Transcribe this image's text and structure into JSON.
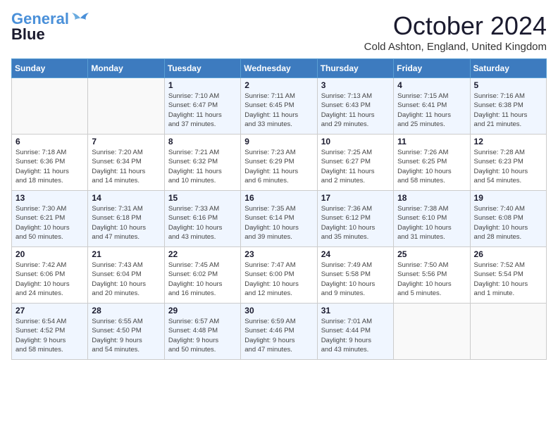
{
  "logo": {
    "line1": "General",
    "line2": "Blue"
  },
  "title": "October 2024",
  "location": "Cold Ashton, England, United Kingdom",
  "days_header": [
    "Sunday",
    "Monday",
    "Tuesday",
    "Wednesday",
    "Thursday",
    "Friday",
    "Saturday"
  ],
  "weeks": [
    [
      {
        "num": "",
        "info": ""
      },
      {
        "num": "",
        "info": ""
      },
      {
        "num": "1",
        "info": "Sunrise: 7:10 AM\nSunset: 6:47 PM\nDaylight: 11 hours\nand 37 minutes."
      },
      {
        "num": "2",
        "info": "Sunrise: 7:11 AM\nSunset: 6:45 PM\nDaylight: 11 hours\nand 33 minutes."
      },
      {
        "num": "3",
        "info": "Sunrise: 7:13 AM\nSunset: 6:43 PM\nDaylight: 11 hours\nand 29 minutes."
      },
      {
        "num": "4",
        "info": "Sunrise: 7:15 AM\nSunset: 6:41 PM\nDaylight: 11 hours\nand 25 minutes."
      },
      {
        "num": "5",
        "info": "Sunrise: 7:16 AM\nSunset: 6:38 PM\nDaylight: 11 hours\nand 21 minutes."
      }
    ],
    [
      {
        "num": "6",
        "info": "Sunrise: 7:18 AM\nSunset: 6:36 PM\nDaylight: 11 hours\nand 18 minutes."
      },
      {
        "num": "7",
        "info": "Sunrise: 7:20 AM\nSunset: 6:34 PM\nDaylight: 11 hours\nand 14 minutes."
      },
      {
        "num": "8",
        "info": "Sunrise: 7:21 AM\nSunset: 6:32 PM\nDaylight: 11 hours\nand 10 minutes."
      },
      {
        "num": "9",
        "info": "Sunrise: 7:23 AM\nSunset: 6:29 PM\nDaylight: 11 hours\nand 6 minutes."
      },
      {
        "num": "10",
        "info": "Sunrise: 7:25 AM\nSunset: 6:27 PM\nDaylight: 11 hours\nand 2 minutes."
      },
      {
        "num": "11",
        "info": "Sunrise: 7:26 AM\nSunset: 6:25 PM\nDaylight: 10 hours\nand 58 minutes."
      },
      {
        "num": "12",
        "info": "Sunrise: 7:28 AM\nSunset: 6:23 PM\nDaylight: 10 hours\nand 54 minutes."
      }
    ],
    [
      {
        "num": "13",
        "info": "Sunrise: 7:30 AM\nSunset: 6:21 PM\nDaylight: 10 hours\nand 50 minutes."
      },
      {
        "num": "14",
        "info": "Sunrise: 7:31 AM\nSunset: 6:18 PM\nDaylight: 10 hours\nand 47 minutes."
      },
      {
        "num": "15",
        "info": "Sunrise: 7:33 AM\nSunset: 6:16 PM\nDaylight: 10 hours\nand 43 minutes."
      },
      {
        "num": "16",
        "info": "Sunrise: 7:35 AM\nSunset: 6:14 PM\nDaylight: 10 hours\nand 39 minutes."
      },
      {
        "num": "17",
        "info": "Sunrise: 7:36 AM\nSunset: 6:12 PM\nDaylight: 10 hours\nand 35 minutes."
      },
      {
        "num": "18",
        "info": "Sunrise: 7:38 AM\nSunset: 6:10 PM\nDaylight: 10 hours\nand 31 minutes."
      },
      {
        "num": "19",
        "info": "Sunrise: 7:40 AM\nSunset: 6:08 PM\nDaylight: 10 hours\nand 28 minutes."
      }
    ],
    [
      {
        "num": "20",
        "info": "Sunrise: 7:42 AM\nSunset: 6:06 PM\nDaylight: 10 hours\nand 24 minutes."
      },
      {
        "num": "21",
        "info": "Sunrise: 7:43 AM\nSunset: 6:04 PM\nDaylight: 10 hours\nand 20 minutes."
      },
      {
        "num": "22",
        "info": "Sunrise: 7:45 AM\nSunset: 6:02 PM\nDaylight: 10 hours\nand 16 minutes."
      },
      {
        "num": "23",
        "info": "Sunrise: 7:47 AM\nSunset: 6:00 PM\nDaylight: 10 hours\nand 12 minutes."
      },
      {
        "num": "24",
        "info": "Sunrise: 7:49 AM\nSunset: 5:58 PM\nDaylight: 10 hours\nand 9 minutes."
      },
      {
        "num": "25",
        "info": "Sunrise: 7:50 AM\nSunset: 5:56 PM\nDaylight: 10 hours\nand 5 minutes."
      },
      {
        "num": "26",
        "info": "Sunrise: 7:52 AM\nSunset: 5:54 PM\nDaylight: 10 hours\nand 1 minute."
      }
    ],
    [
      {
        "num": "27",
        "info": "Sunrise: 6:54 AM\nSunset: 4:52 PM\nDaylight: 9 hours\nand 58 minutes."
      },
      {
        "num": "28",
        "info": "Sunrise: 6:55 AM\nSunset: 4:50 PM\nDaylight: 9 hours\nand 54 minutes."
      },
      {
        "num": "29",
        "info": "Sunrise: 6:57 AM\nSunset: 4:48 PM\nDaylight: 9 hours\nand 50 minutes."
      },
      {
        "num": "30",
        "info": "Sunrise: 6:59 AM\nSunset: 4:46 PM\nDaylight: 9 hours\nand 47 minutes."
      },
      {
        "num": "31",
        "info": "Sunrise: 7:01 AM\nSunset: 4:44 PM\nDaylight: 9 hours\nand 43 minutes."
      },
      {
        "num": "",
        "info": ""
      },
      {
        "num": "",
        "info": ""
      }
    ]
  ]
}
